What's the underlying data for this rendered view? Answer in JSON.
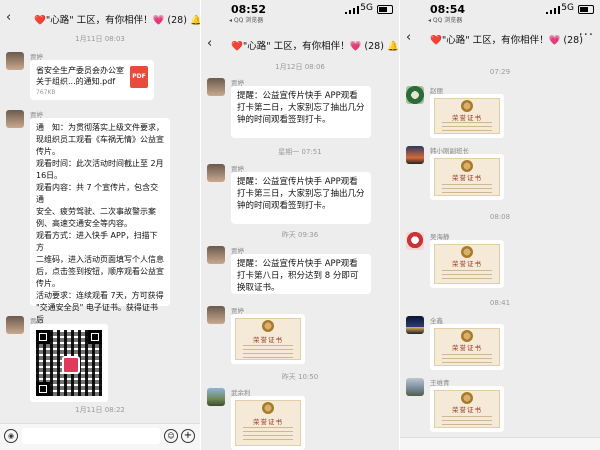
{
  "chat_title": "❤️\"心路\" 工区，有你相伴！💗 (28)",
  "panel1": {
    "header_title": "❤️\"心路\" 工区，有你相伴！💗 (28) 🔔",
    "timestamp_top": "1月11日 08:03",
    "sender": "贾婷",
    "file_name": "省安全生产委员会办公室关于组织...的通知.pdf",
    "file_size": "767KB",
    "file_icon_label": "PDF",
    "notice_lines": [
      "通　知：为贯彻落实上级文件要求，",
      "现组织员工观看《车祸无情》公益宣",
      "传片。",
      "观看时间：此次活动时间截止至 2月",
      "16日。",
      "观看内容：共 7 个宣传片，包含交通",
      "安全、疲劳驾驶、二次事故警示案",
      "例、高速交通安全等内容。",
      "观看方式：进入快手 APP，扫描下方",
      "二维码，进入活动页面填写个人信息",
      "后，点击签到按钮，顺序观看公益宣",
      "传片。",
      "活动要求：连续观看 7天，方可获得",
      "\"交通安全员\" 电子证书。获得证书后",
      "发至群内。"
    ],
    "timestamp_bottom": "1月11日 08:22"
  },
  "panel2": {
    "status_time": "08:52",
    "status_source": "◂ QQ 浏览器",
    "network": "5G",
    "header_title": "❤️\"心路\" 工区，有你相伴！💗 (28) 🔔",
    "timestamp_1": "1月12日 08:06",
    "sender": "贾婷",
    "msg_1": "提醒：公益宣传片快手 APP观看打卡第二日，大家别忘了抽出几分钟的时间观看签到打卡。",
    "timestamp_2": "星期一 07:51",
    "msg_2": "提醒：公益宣传片快手 APP观看打卡第三日，大家别忘了抽出几分钟的时间观看签到打卡。",
    "timestamp_3": "昨天 09:36",
    "msg_3": "提醒：公益宣传片快手 APP观看打卡第八日，积分达到 8 分即可换取证书。",
    "cert_title": "荣誉证书",
    "timestamp_4": "昨天 10:50",
    "sender_2": "武余利"
  },
  "panel3": {
    "status_time": "08:54",
    "status_source": "◂ QQ 浏览器",
    "network": "5G",
    "header_title": "❤️\"心路\" 工区，有你相伴！💗 (28)",
    "timestamp_1": "07:29",
    "sender_1": "赵丽",
    "sender_2": "韩小刚副班长",
    "timestamp_2": "08:08",
    "sender_3": "吴海静",
    "timestamp_3": "08:41",
    "sender_4": "全鑫",
    "sender_5": "王维青",
    "cert_title": "荣誉证书"
  },
  "icons": {
    "back": "‹",
    "more": "···",
    "voice": "◉",
    "emoji": "☺",
    "plus": "+"
  }
}
